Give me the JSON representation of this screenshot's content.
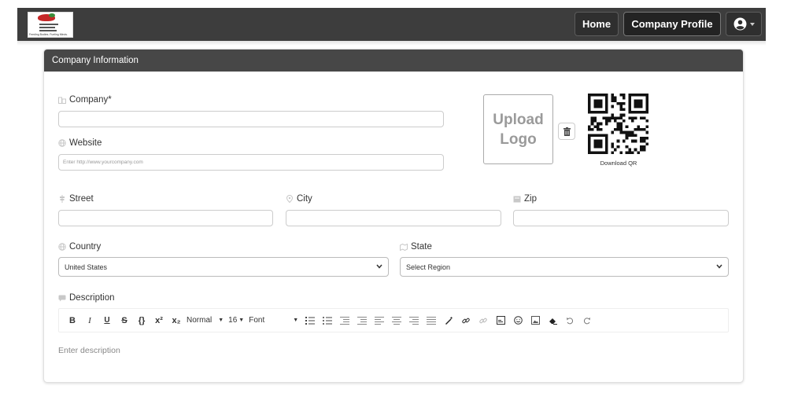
{
  "nav": {
    "logo_tagline": "Feeding Bodies. Fueling Minds.",
    "home_label": "Home",
    "company_profile_label": "Company Profile"
  },
  "card": {
    "title": "Company Information"
  },
  "form": {
    "company_label": "Company*",
    "company_value": "",
    "website_label": "Website",
    "website_placeholder": "Enter http://www.yourcompany.com",
    "street_label": "Street",
    "city_label": "City",
    "zip_label": "Zip",
    "country_label": "Country",
    "country_value": "United States",
    "state_label": "State",
    "state_value": "Select Region",
    "description_label": "Description",
    "description_placeholder": "Enter description"
  },
  "logo_upload": {
    "line1": "Upload",
    "line2": "Logo"
  },
  "qr": {
    "download_label": "Download QR"
  },
  "editor": {
    "bold": "B",
    "italic": "I",
    "underline": "U",
    "strike": "S",
    "code": "{}",
    "superscript": "x²",
    "subscript": "x₂",
    "paragraph_style": "Normal",
    "font_size": "16",
    "font_family": "Font"
  },
  "colors": {
    "topbar": "#3d3d3d",
    "card_header": "#474747",
    "upload_text": "#9a9a9a"
  }
}
